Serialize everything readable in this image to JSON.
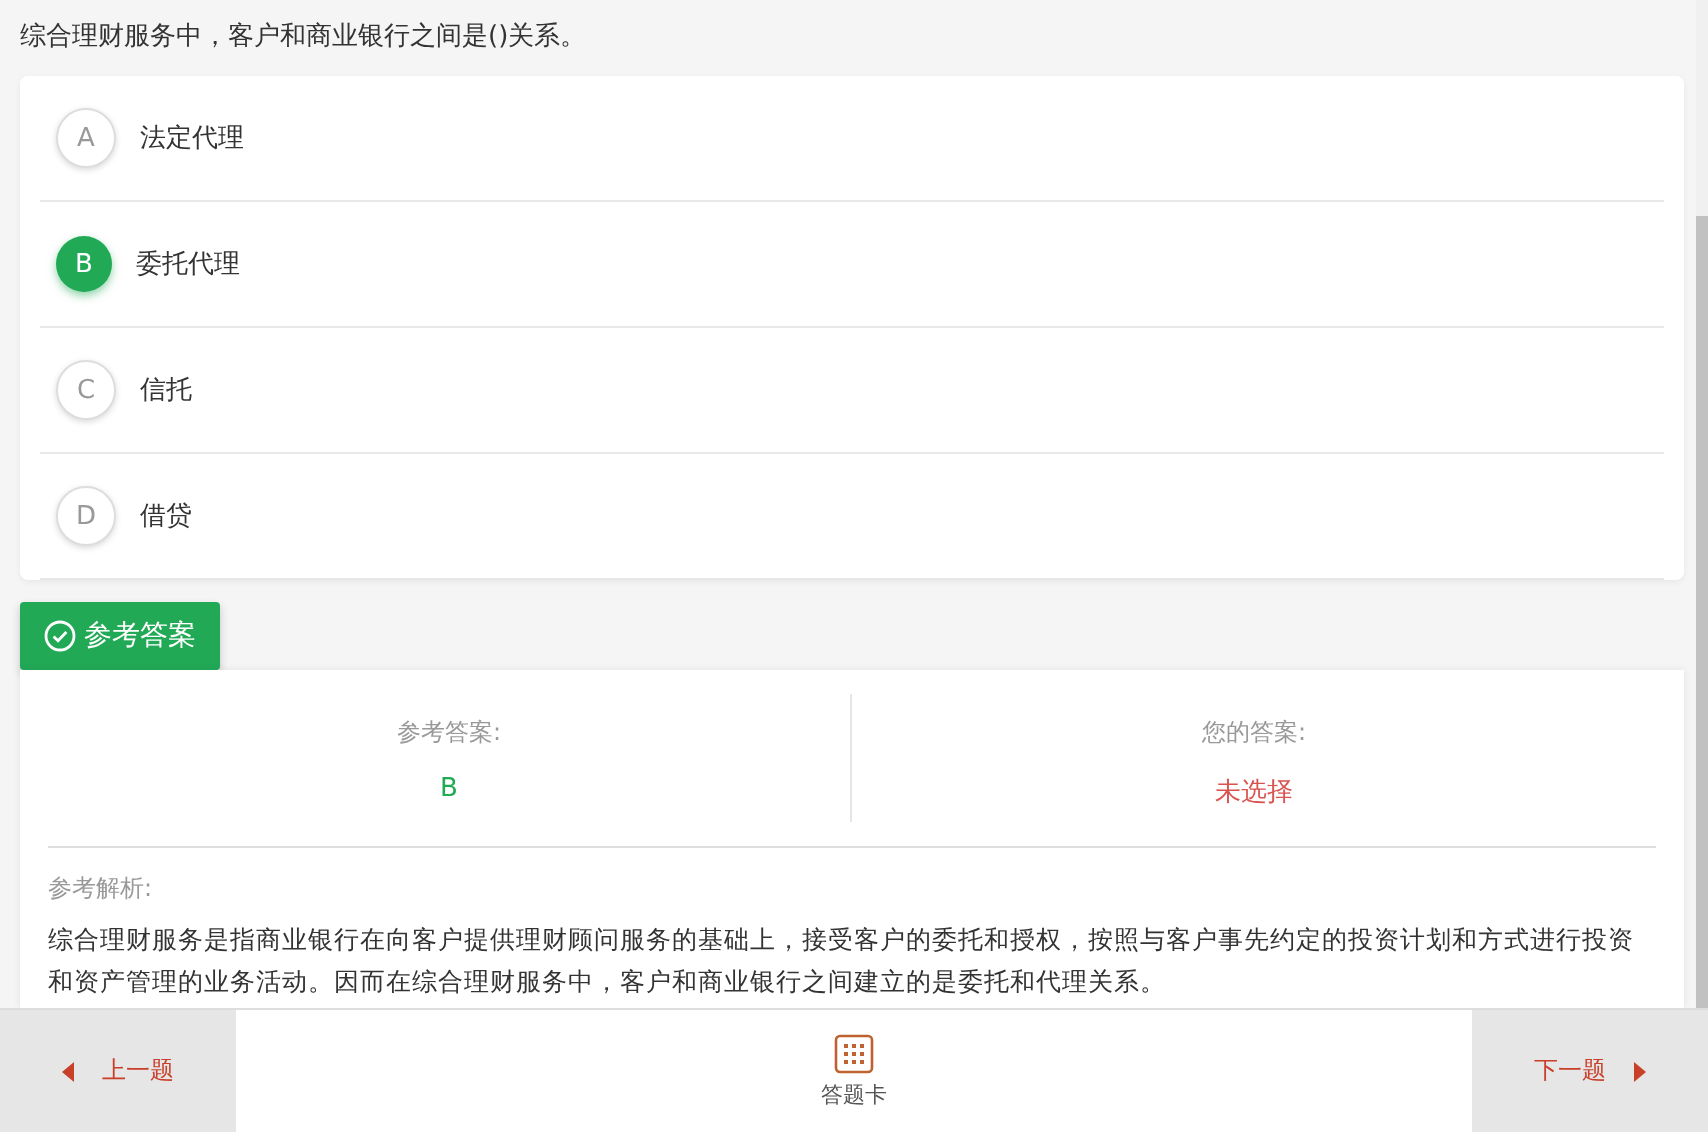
{
  "question": "综合理财服务中，客户和商业银行之间是()关系。",
  "options": [
    {
      "letter": "A",
      "text": "法定代理",
      "selected": false
    },
    {
      "letter": "B",
      "text": "委托代理",
      "selected": true
    },
    {
      "letter": "C",
      "text": "信托",
      "selected": false
    },
    {
      "letter": "D",
      "text": "借贷",
      "selected": false
    }
  ],
  "answer_tab": "参考答案",
  "reference": {
    "label": "参考答案:",
    "value": "B"
  },
  "yours": {
    "label": "您的答案:",
    "value": "未选择"
  },
  "analysis": {
    "label": "参考解析:",
    "text": "综合理财服务是指商业银行在向客户提供理财顾问服务的基础上，接受客户的委托和授权，按照与客户事先约定的投资计划和方式进行投资和资产管理的业务活动。因而在综合理财服务中，客户和商业银行之间建立的是委托和代理关系。"
  },
  "footer": {
    "prev": "上一题",
    "card": "答题卡",
    "next": "下一题"
  }
}
